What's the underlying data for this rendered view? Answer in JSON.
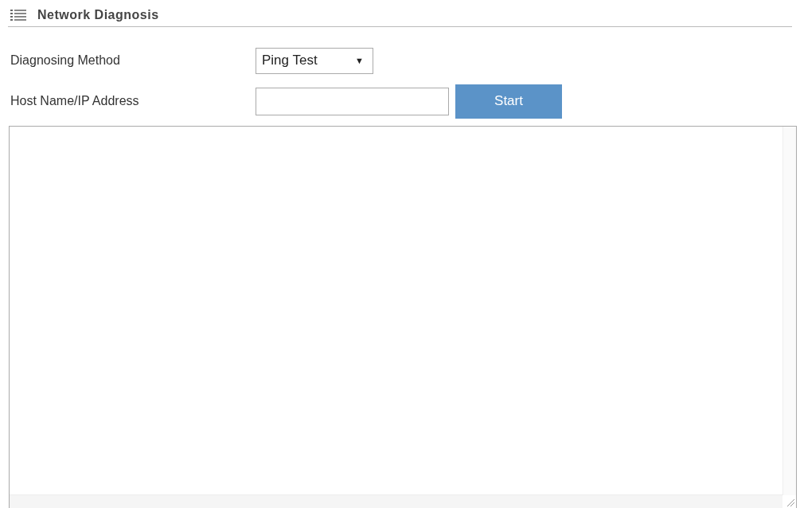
{
  "section": {
    "title": "Network Diagnosis"
  },
  "form": {
    "method_label": "Diagnosing Method",
    "method_value": "Ping Test",
    "method_caret": "▼",
    "host_label": "Host Name/IP Address",
    "start_button": "Start"
  }
}
